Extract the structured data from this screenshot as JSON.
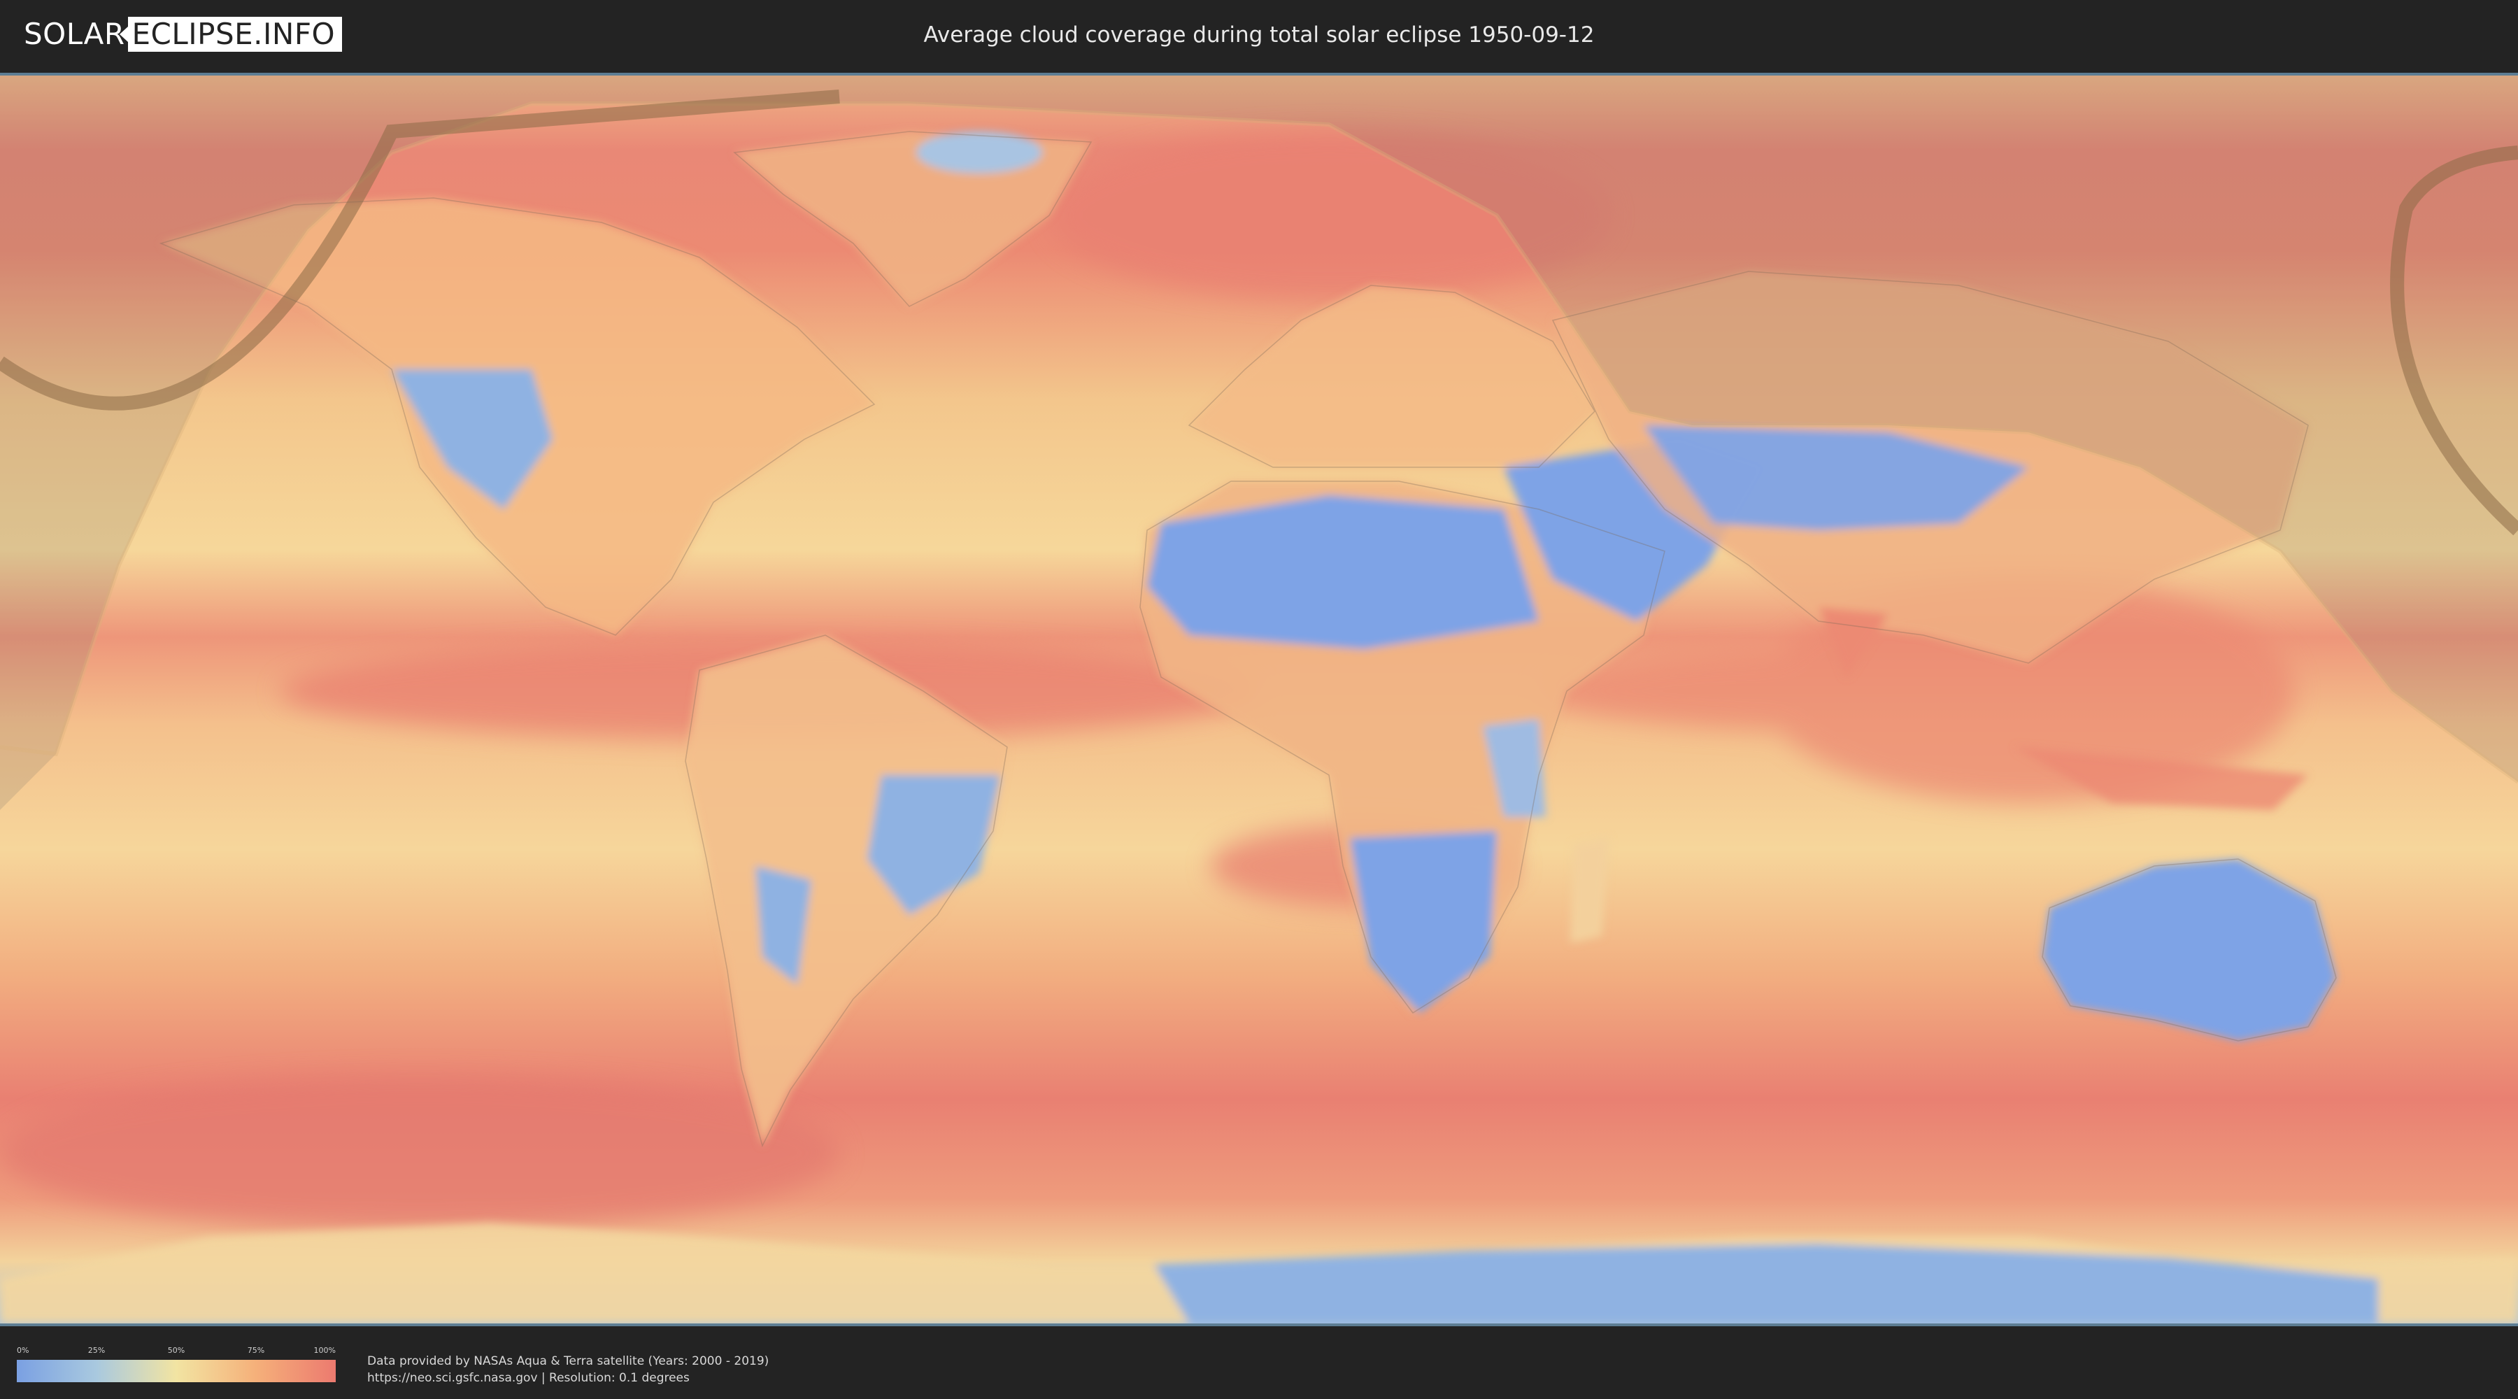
{
  "header": {
    "logo_part1": "SOLAR",
    "logo_part2": "ECLIPSE.INFO",
    "title": "Average cloud coverage during total solar eclipse 1950-09-12"
  },
  "map": {
    "layer": "average cloud coverage",
    "colors": {
      "clear": "#7aa0e2",
      "low": "#a9c9df",
      "mid": "#f2e4a2",
      "high": "#f5b07a",
      "overcast": "#ec7a6f",
      "eclipse_path": "#8a6a45",
      "frame": "#5d7d93"
    }
  },
  "legend": {
    "ticks": [
      "0%",
      "25%",
      "50%",
      "75%",
      "100%"
    ]
  },
  "credits": {
    "line1": "Data provided by NASAs Aqua & Terra satellite (Years: 2000 - 2019)",
    "line2": "https://neo.sci.gsfc.nasa.gov | Resolution: 0.1 degrees"
  }
}
